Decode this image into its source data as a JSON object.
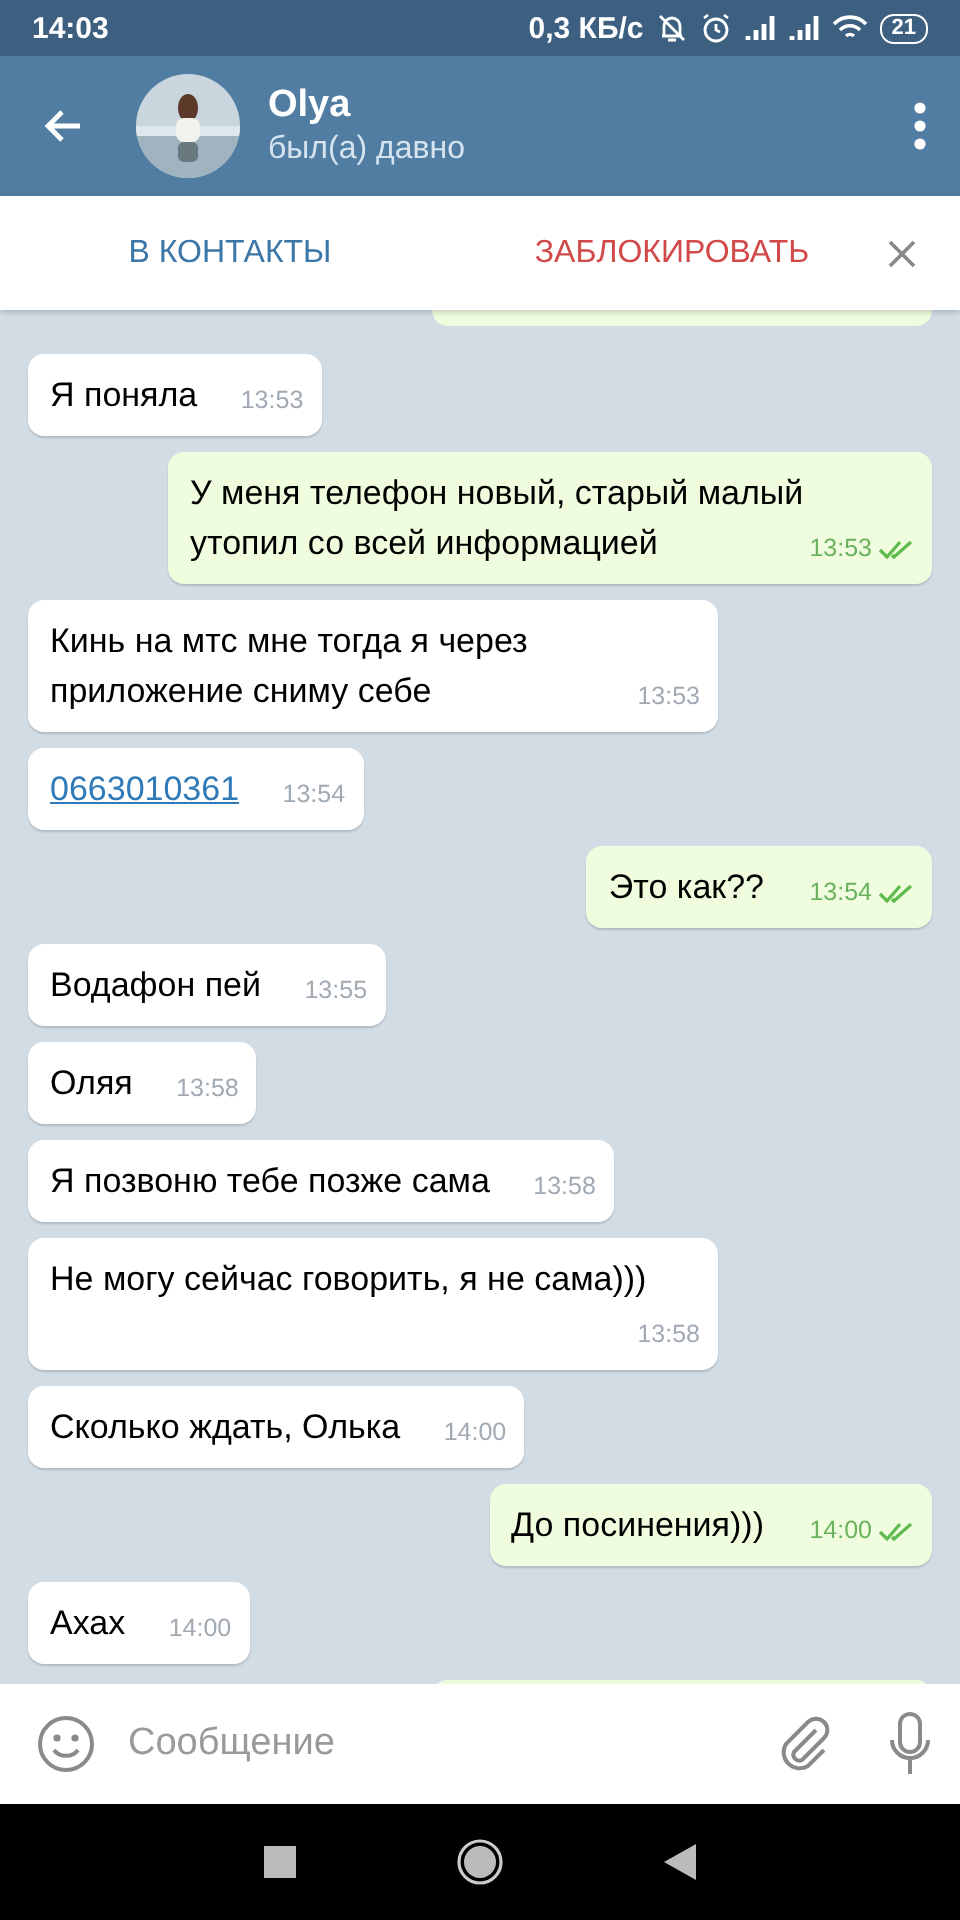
{
  "status_bar": {
    "time": "14:03",
    "speed": "0,3 КБ/с",
    "battery": "21"
  },
  "header": {
    "name": "Olya",
    "status": "был(а) давно"
  },
  "action_bar": {
    "add_contact": "В КОНТАКТЫ",
    "block": "ЗАБЛОКИРОВАТЬ"
  },
  "messages": [
    {
      "kind": "cut",
      "outgoing": true
    },
    {
      "kind": "text",
      "outgoing": false,
      "text": "Я поняла",
      "time": "13:53"
    },
    {
      "kind": "text",
      "outgoing": true,
      "text": "У меня телефон новый, старый малый утопил со всей информацией",
      "time": "13:53",
      "read": true
    },
    {
      "kind": "text",
      "outgoing": false,
      "text": "Кинь на мтс мне тогда я через приложение сниму себе",
      "time": "13:53"
    },
    {
      "kind": "link",
      "outgoing": false,
      "text": "0663010361",
      "time": "13:54"
    },
    {
      "kind": "text",
      "outgoing": true,
      "text": "Это как??",
      "time": "13:54",
      "read": true
    },
    {
      "kind": "text",
      "outgoing": false,
      "text": "Водафон пей",
      "time": "13:55"
    },
    {
      "kind": "text",
      "outgoing": false,
      "text": "Оляя",
      "time": "13:58"
    },
    {
      "kind": "text",
      "outgoing": false,
      "text": "Я позвоню тебе позже сама",
      "time": "13:58"
    },
    {
      "kind": "text",
      "outgoing": false,
      "text": "Не могу сейчас говорить, я не сама)))",
      "time": "13:58"
    },
    {
      "kind": "text",
      "outgoing": false,
      "text": "Сколько ждать, Олька",
      "time": "14:00"
    },
    {
      "kind": "text",
      "outgoing": true,
      "text": "До посинения)))",
      "time": "14:00",
      "read": true
    },
    {
      "kind": "text",
      "outgoing": false,
      "text": "Ахах",
      "time": "14:00"
    },
    {
      "kind": "cut",
      "outgoing": true
    }
  ],
  "composer": {
    "placeholder": "Сообщение"
  }
}
